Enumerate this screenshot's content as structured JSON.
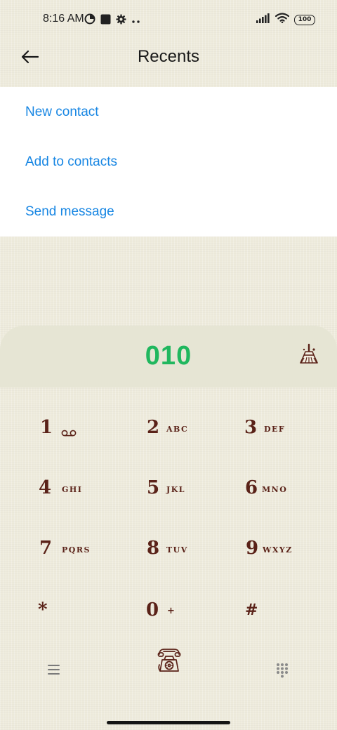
{
  "status_bar": {
    "time": "8:16 AM",
    "battery": "100",
    "icons": [
      "data-saver-icon",
      "square-notification-icon",
      "settings-icon",
      "more-dots-icon",
      "signal-icon",
      "wifi-icon",
      "battery-icon"
    ]
  },
  "header": {
    "title": "Recents",
    "back_icon": "back-arrow-icon"
  },
  "actions": [
    {
      "label": "New contact"
    },
    {
      "label": "Add to contacts"
    },
    {
      "label": "Send message"
    }
  ],
  "dialer": {
    "number": "010",
    "clear_icon": "clear-broom-icon",
    "keys": [
      {
        "digit": "1",
        "letters": "",
        "icon": "voicemail-icon"
      },
      {
        "digit": "2",
        "letters": "ABC"
      },
      {
        "digit": "3",
        "letters": "DEF"
      },
      {
        "digit": "4",
        "letters": "GHI"
      },
      {
        "digit": "5",
        "letters": "JKL"
      },
      {
        "digit": "6",
        "letters": "MNO"
      },
      {
        "digit": "7",
        "letters": "PQRS"
      },
      {
        "digit": "8",
        "letters": "TUV"
      },
      {
        "digit": "9",
        "letters": "WXYZ"
      },
      {
        "digit": "*",
        "letters": ""
      },
      {
        "digit": "0",
        "letters": "+"
      },
      {
        "digit": "#",
        "letters": ""
      }
    ]
  },
  "bottom_bar": {
    "menu_icon": "menu-icon",
    "call_icon": "vintage-phone-icon",
    "keypad_icon": "keypad-grid-icon"
  },
  "colors": {
    "accent_link": "#1786e3",
    "number": "#20b75e",
    "key_text": "#5a2218",
    "background": "#eeebdc"
  }
}
